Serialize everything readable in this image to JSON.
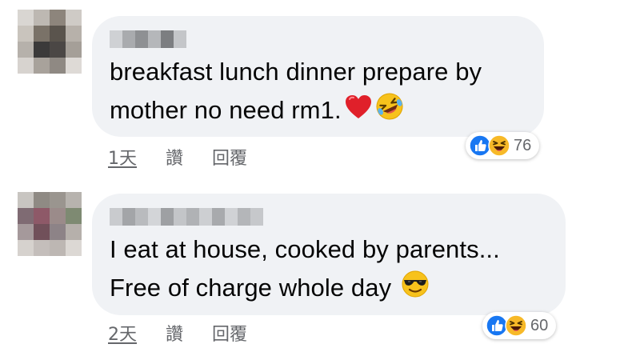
{
  "comments": [
    {
      "text_line1": "breakfast lunch dinner prepare by",
      "text_line2": "mother no need rm1.",
      "emojis": [
        "red-heart-emoji",
        "rolling-laughing-emoji"
      ],
      "reaction_count": "76",
      "reaction_icons": [
        "like-reaction-icon",
        "haha-reaction-icon"
      ],
      "time": "1天",
      "like_label": "讚",
      "reply_label": "回覆"
    },
    {
      "text_line1": "I eat at house, cooked by parents...",
      "text_line2": "Free of charge whole day",
      "emojis": [
        "sunglasses-emoji"
      ],
      "reaction_count": "60",
      "reaction_icons": [
        "like-reaction-icon",
        "haha-reaction-icon"
      ],
      "time": "2天",
      "like_label": "讚",
      "reply_label": "回覆"
    }
  ],
  "colors": {
    "bubble": "#f0f2f5",
    "meta_text": "#65676b",
    "like_blue": "#1877f2",
    "haha_yellow": "#f7b928"
  }
}
